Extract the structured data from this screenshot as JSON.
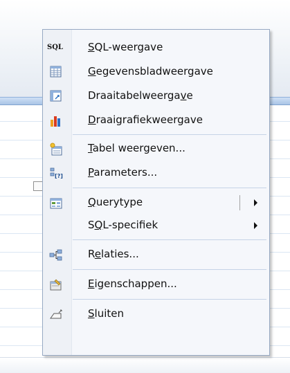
{
  "context_menu": {
    "items": [
      {
        "key": "sql",
        "icon": "sql-icon",
        "pre": "",
        "ul": "S",
        "post": "QL-weergave",
        "submenu": false,
        "icon_text": "SQL"
      },
      {
        "key": "datasheet",
        "icon": "datasheet-icon",
        "pre": "",
        "ul": "G",
        "post": "egevensbladweergave",
        "submenu": false
      },
      {
        "key": "pivottable",
        "icon": "pivottable-icon",
        "pre": "Draaitabelweerga",
        "ul": "v",
        "post": "e",
        "submenu": false
      },
      {
        "key": "pivotchart",
        "icon": "pivotchart-icon",
        "pre": "",
        "ul": "D",
        "post": "raaigrafiekweergave",
        "submenu": false
      },
      {
        "key": "showtable",
        "icon": "showtable-icon",
        "pre": "",
        "ul": "T",
        "post": "abel weergeven...",
        "submenu": false
      },
      {
        "key": "parameters",
        "icon": "parameters-icon",
        "pre": "",
        "ul": "P",
        "post": "arameters...",
        "submenu": false,
        "icon_text": "[?]"
      },
      {
        "key": "querytype",
        "icon": "querytype-icon",
        "pre": "",
        "ul": "Q",
        "post": "uerytype",
        "submenu": true
      },
      {
        "key": "sqlspecific",
        "icon": "",
        "pre": "S",
        "ul": "Q",
        "post": "L-specifiek",
        "submenu": true
      },
      {
        "key": "relations",
        "icon": "relations-icon",
        "pre": "R",
        "ul": "e",
        "post": "laties...",
        "submenu": false
      },
      {
        "key": "properties",
        "icon": "properties-icon",
        "pre": "",
        "ul": "E",
        "post": "igenschappen...",
        "submenu": false
      },
      {
        "key": "close",
        "icon": "close-icon",
        "pre": "",
        "ul": "S",
        "post": "luiten",
        "submenu": false
      }
    ]
  }
}
